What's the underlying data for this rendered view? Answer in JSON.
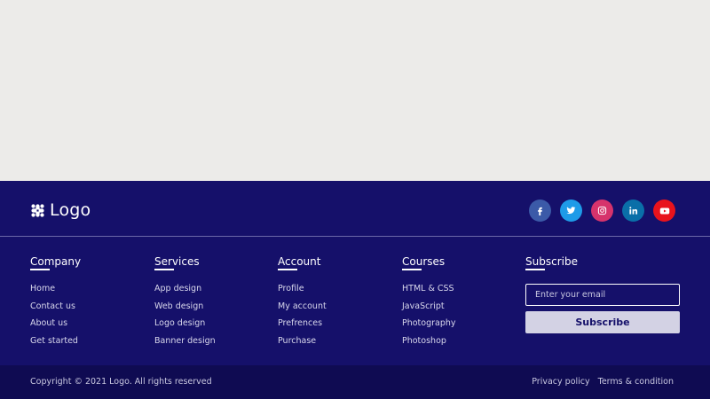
{
  "brand": {
    "logo_text": "Logo",
    "logo_icon": "slack-hash-icon"
  },
  "social": [
    {
      "name": "facebook",
      "glyph": "f",
      "color": "#3b5aa8"
    },
    {
      "name": "twitter",
      "glyph": "t",
      "color": "#1e9be8"
    },
    {
      "name": "instagram",
      "glyph": "ig",
      "color": "#d6336c"
    },
    {
      "name": "linkedin",
      "glyph": "in",
      "color": "#0a6fa8"
    },
    {
      "name": "youtube",
      "glyph": "yt",
      "color": "#e8131c"
    }
  ],
  "columns": {
    "company": {
      "title": "Company",
      "items": [
        "Home",
        "Contact us",
        "About us",
        "Get started"
      ]
    },
    "services": {
      "title": "Services",
      "items": [
        "App design",
        "Web design",
        "Logo design",
        "Banner design"
      ]
    },
    "account": {
      "title": "Account",
      "items": [
        "Profile",
        "My account",
        "Prefrences",
        "Purchase"
      ]
    },
    "courses": {
      "title": "Courses",
      "items": [
        "HTML & CSS",
        "JavaScript",
        "Photography",
        "Photoshop"
      ]
    }
  },
  "subscribe": {
    "title": "Subscribe",
    "placeholder": "Enter your email",
    "value": "",
    "button_label": "Subscribe"
  },
  "bottom": {
    "copyright": "Copyright © 2021 Logo.  All rights reserved",
    "links": [
      "Privacy policy",
      "Terms & condition"
    ]
  },
  "colors": {
    "page_background": "#ecebe9",
    "footer_background": "#15106a",
    "bottom_bar_background": "#0f0b52",
    "button_background": "#d3d2e4"
  }
}
